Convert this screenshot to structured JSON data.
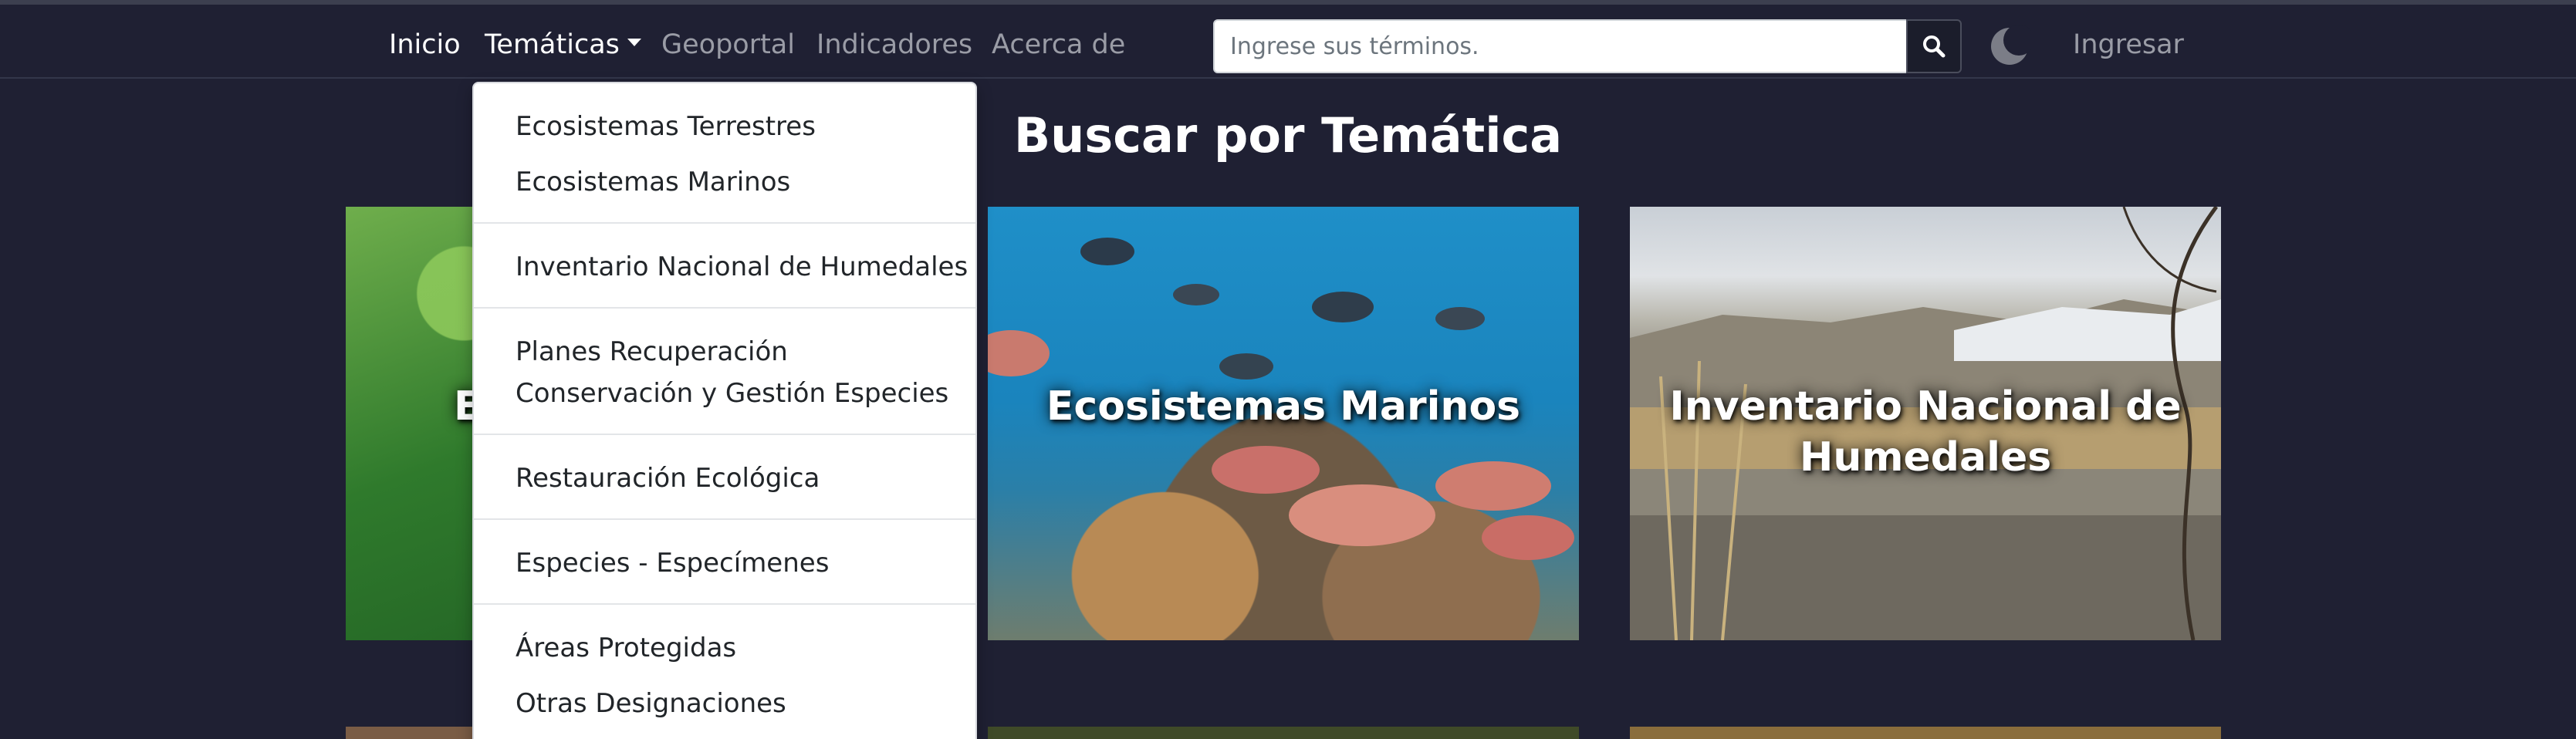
{
  "navbar": {
    "links": [
      {
        "label": "Inicio"
      },
      {
        "label": "Temáticas"
      },
      {
        "label": "Geoportal"
      },
      {
        "label": "Indicadores"
      },
      {
        "label": "Acerca de"
      }
    ],
    "search_placeholder": "Ingrese sus términos.",
    "login_label": "Ingresar"
  },
  "dropdown": {
    "items": [
      "Ecosistemas Terrestres",
      "Ecosistemas Marinos",
      "Inventario Nacional de Humedales",
      "Planes Recuperación",
      "Conservación y Gestión Especies",
      "Restauración Ecológica",
      "Especies - Especímenes",
      "Áreas Protegidas",
      "Otras Designaciones"
    ]
  },
  "main": {
    "title": "Buscar por Temática",
    "cards": [
      {
        "label": "Ec"
      },
      {
        "label": "Ecosistemas Marinos"
      },
      {
        "label": "Inventario Nacional de Humedales"
      }
    ]
  },
  "colors": {
    "background": "#1f2033",
    "active_link": "#ffffff",
    "muted_link": "#9a9ca6"
  },
  "icons": {
    "search": "search-icon",
    "theme_toggle": "moon-icon",
    "dropdown_caret": "caret-down-icon"
  }
}
